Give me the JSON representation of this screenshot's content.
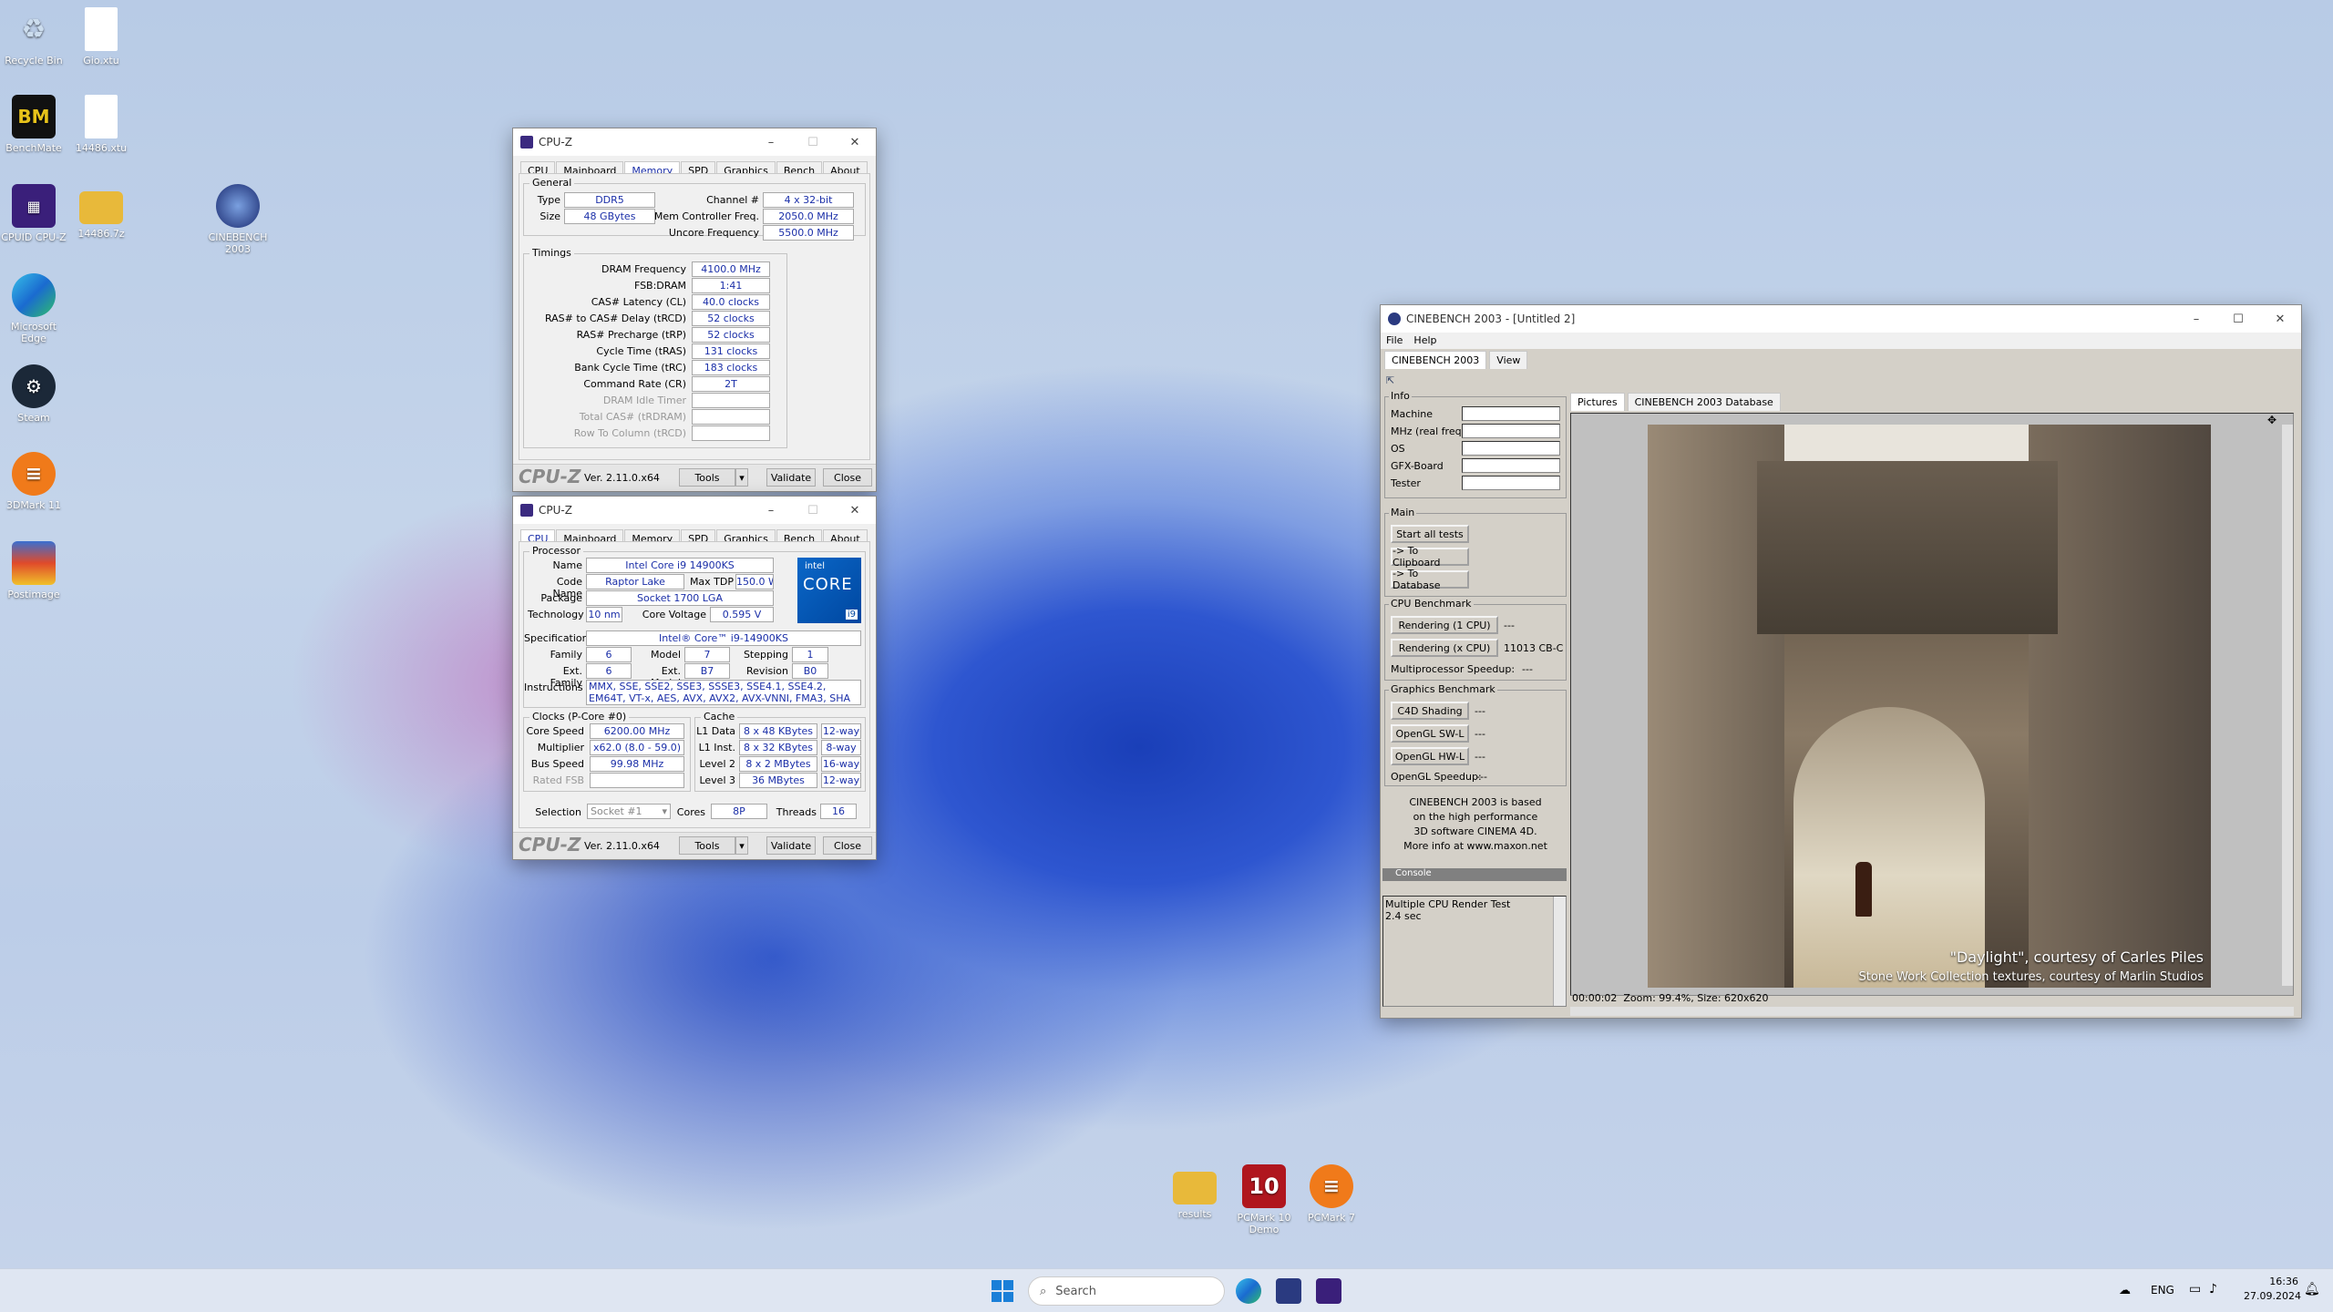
{
  "desktop_icons": [
    {
      "label": "Recycle Bin",
      "icon": "recycle-bin-icon"
    },
    {
      "label": "Gio.xtu",
      "icon": "file-icon"
    },
    {
      "label": "BenchMate",
      "icon": "benchmate-icon"
    },
    {
      "label": "14486.xtu",
      "icon": "file-icon"
    },
    {
      "label": "CPUID CPU-Z",
      "icon": "cpuz-icon"
    },
    {
      "label": "14486.7z",
      "icon": "folder-icon"
    },
    {
      "label": "CINEBENCH 2003",
      "icon": "cinebench-icon"
    },
    {
      "label": "Microsoft Edge",
      "icon": "edge-icon"
    },
    {
      "label": "Steam",
      "icon": "steam-icon"
    },
    {
      "label": "3DMark 11",
      "icon": "3dmark-icon"
    },
    {
      "label": "Postimage",
      "icon": "postimage-icon"
    },
    {
      "label": "results",
      "icon": "folder-icon"
    },
    {
      "label": "PCMark 10 Demo",
      "icon": "pcmark10-icon"
    },
    {
      "label": "PCMark 7",
      "icon": "pcmark7-icon"
    }
  ],
  "cpuz_mem": {
    "title": "CPU-Z",
    "tabs": [
      "CPU",
      "Mainboard",
      "Memory",
      "SPD",
      "Graphics",
      "Bench",
      "About"
    ],
    "general_label": "General",
    "type_label": "Type",
    "type": "DDR5",
    "size_label": "Size",
    "size": "48 GBytes",
    "channel_label": "Channel #",
    "channel": "4 x 32-bit",
    "mcf_label": "Mem Controller Freq.",
    "mcf": "2050.0 MHz",
    "uncore_label": "Uncore Frequency",
    "uncore": "5500.0 MHz",
    "timings_label": "Timings",
    "timings": [
      {
        "label": "DRAM Frequency",
        "value": "4100.0 MHz"
      },
      {
        "label": "FSB:DRAM",
        "value": "1:41"
      },
      {
        "label": "CAS# Latency (CL)",
        "value": "40.0 clocks"
      },
      {
        "label": "RAS# to CAS# Delay (tRCD)",
        "value": "52 clocks"
      },
      {
        "label": "RAS# Precharge (tRP)",
        "value": "52 clocks"
      },
      {
        "label": "Cycle Time (tRAS)",
        "value": "131 clocks"
      },
      {
        "label": "Bank Cycle Time (tRC)",
        "value": "183 clocks"
      },
      {
        "label": "Command Rate (CR)",
        "value": "2T"
      },
      {
        "label": "DRAM Idle Timer",
        "value": ""
      },
      {
        "label": "Total CAS# (tRDRAM)",
        "value": ""
      },
      {
        "label": "Row To Column (tRCD)",
        "value": ""
      }
    ],
    "logo": "CPU-Z",
    "version": "Ver. 2.11.0.x64",
    "tools": "Tools",
    "validate": "Validate",
    "close": "Close"
  },
  "cpuz_cpu": {
    "title": "CPU-Z",
    "tabs": [
      "CPU",
      "Mainboard",
      "Memory",
      "SPD",
      "Graphics",
      "Bench",
      "About"
    ],
    "processor_label": "Processor",
    "name_label": "Name",
    "name": "Intel Core i9 14900KS",
    "codename_label": "Code Name",
    "codename": "Raptor Lake",
    "maxtdp_label": "Max TDP",
    "maxtdp": "150.0 W",
    "package_label": "Package",
    "package": "Socket 1700 LGA",
    "technology_label": "Technology",
    "technology": "10 nm",
    "corevoltage_label": "Core Voltage",
    "corevoltage": "0.595 V",
    "spec_label": "Specification",
    "spec": "Intel® Core™ i9-14900KS",
    "family_label": "Family",
    "family": "6",
    "model_label": "Model",
    "model": "7",
    "stepping_label": "Stepping",
    "stepping": "1",
    "extfamily_label": "Ext. Family",
    "extfamily": "6",
    "extmodel_label": "Ext. Model",
    "extmodel": "B7",
    "revision_label": "Revision",
    "revision": "B0",
    "instr_label": "Instructions",
    "instr": "MMX, SSE, SSE2, SSE3, SSSE3, SSE4.1, SSE4.2, EM64T, VT-x, AES, AVX, AVX2, AVX-VNNI, FMA3, SHA",
    "intel_badge": "intel",
    "core_badge": "CORE",
    "i9_badge": "i9",
    "clocks_label": "Clocks (P-Core #0)",
    "corespeed_label": "Core Speed",
    "corespeed": "6200.00 MHz",
    "multiplier_label": "Multiplier",
    "multiplier": "x62.0 (8.0 - 59.0)",
    "busspeed_label": "Bus Speed",
    "busspeed": "99.98 MHz",
    "ratedfsb_label": "Rated FSB",
    "ratedfsb": "",
    "cache_label": "Cache",
    "cache": [
      {
        "label": "L1 Data",
        "size": "8 x 48 KBytes",
        "way": "12-way"
      },
      {
        "label": "L1 Inst.",
        "size": "8 x 32 KBytes",
        "way": "8-way"
      },
      {
        "label": "Level 2",
        "size": "8 x 2 MBytes",
        "way": "16-way"
      },
      {
        "label": "Level 3",
        "size": "36 MBytes",
        "way": "12-way"
      }
    ],
    "selection_label": "Selection",
    "selection": "Socket #1",
    "cores_label": "Cores",
    "cores": "8P",
    "threads_label": "Threads",
    "threads": "16",
    "logo": "CPU-Z",
    "version": "Ver. 2.11.0.x64",
    "tools": "Tools",
    "validate": "Validate",
    "close": "Close"
  },
  "cinebench": {
    "title": "CINEBENCH 2003 - [Untitled 2]",
    "menu": [
      "File",
      "Help"
    ],
    "tabs": [
      "CINEBENCH 2003",
      "View"
    ],
    "info_label": "Info",
    "info_fields": [
      "Machine",
      "MHz (real freq.)",
      "OS",
      "GFX-Board",
      "Tester"
    ],
    "main_label": "Main",
    "main_buttons": [
      "Start all tests",
      "-> To Clipboard",
      "-> To Database"
    ],
    "cpu_label": "CPU Benchmark",
    "render1": "Rendering (1 CPU)",
    "render1_result": "---",
    "renderx": "Rendering (x CPU)",
    "renderx_result": "11013 CB-CPU",
    "mp_speedup": "Multiprocessor Speedup:",
    "mp_speedup_val": "---",
    "gfx_label": "Graphics Benchmark",
    "gfx": [
      {
        "label": "C4D Shading",
        "val": "---"
      },
      {
        "label": "OpenGL SW-L",
        "val": "---"
      },
      {
        "label": "OpenGL HW-L",
        "val": "---"
      }
    ],
    "ogl_speedup": "OpenGL Speedup:",
    "ogl_speedup_val": "---",
    "about": [
      "CINEBENCH 2003 is based",
      "on the high performance",
      "3D software CINEMA 4D.",
      "More info at www.maxon.net"
    ],
    "console_label": "Console",
    "console_lines": [
      "Multiple CPU Render Test",
      "2.4 sec"
    ],
    "picture_tabs": [
      "Pictures",
      "CINEBENCH 2003 Database"
    ],
    "caption1": "\"Daylight\", courtesy of Carles Piles",
    "caption2": "Stone Work Collection textures, courtesy of Marlin Studios",
    "status": "00:00:02  Zoom: 99.4%, Size: 620x620"
  },
  "taskbar": {
    "search": "Search",
    "lang": "ENG",
    "time": "16:36",
    "date": "27.09.2024"
  }
}
